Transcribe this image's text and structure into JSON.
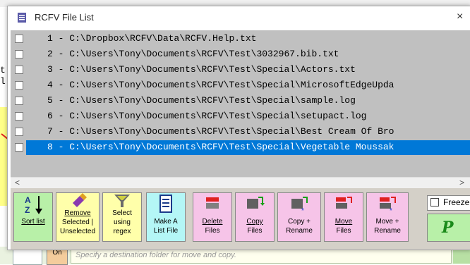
{
  "window": {
    "title": "RCFV File List",
    "close_glyph": "×"
  },
  "background_app": {
    "left_text": "t\nl",
    "on_button": "On",
    "hint": "Specify a destination folder for move and copy."
  },
  "files": [
    {
      "label": "1 - C:\\Dropbox\\RCFV\\Data\\RCFV.Help.txt",
      "selected": false
    },
    {
      "label": "2 - C:\\Users\\Tony\\Documents\\RCFV\\Test\\3032967.bib.txt",
      "selected": false
    },
    {
      "label": "3 - C:\\Users\\Tony\\Documents\\RCFV\\Test\\Special\\Actors.txt",
      "selected": false
    },
    {
      "label": "4 - C:\\Users\\Tony\\Documents\\RCFV\\Test\\Special\\MicrosoftEdgeUpda",
      "selected": false
    },
    {
      "label": "5 - C:\\Users\\Tony\\Documents\\RCFV\\Test\\Special\\sample.log",
      "selected": false
    },
    {
      "label": "6 - C:\\Users\\Tony\\Documents\\RCFV\\Test\\Special\\setupact.log",
      "selected": false
    },
    {
      "label": "7 - C:\\Users\\Tony\\Documents\\RCFV\\Test\\Special\\Best Cream Of Bro",
      "selected": false
    },
    {
      "label": "8 - C:\\Users\\Tony\\Documents\\RCFV\\Test\\Special\\Vegetable Moussak",
      "selected": true
    }
  ],
  "scroll": {
    "left": "<",
    "right": ">"
  },
  "toolbar": {
    "sort_line1": "Sort list",
    "remove_line1": "Remove",
    "remove_line2": "Selected |",
    "remove_line3": "Unselected",
    "select_line1": "Select",
    "select_line2": "using",
    "select_line3": "regex",
    "make_line1": "Make A",
    "make_line2": "List File",
    "delete_line1": "Delete",
    "delete_line2": "Files",
    "copy_line1": "Copy",
    "copy_line2": "Files",
    "copyren_line1": "Copy +",
    "copyren_line2": "Rename",
    "move_line1": "Move",
    "move_line2": "Files",
    "moveren_line1": "Move +",
    "moveren_line2": "Rename",
    "freeze_label": "Freeze",
    "help_glyph": "P"
  },
  "colors": {
    "selection": "#0078d7",
    "list_bg": "#c0c0c0",
    "accent_yellow": "#ffffaa"
  }
}
